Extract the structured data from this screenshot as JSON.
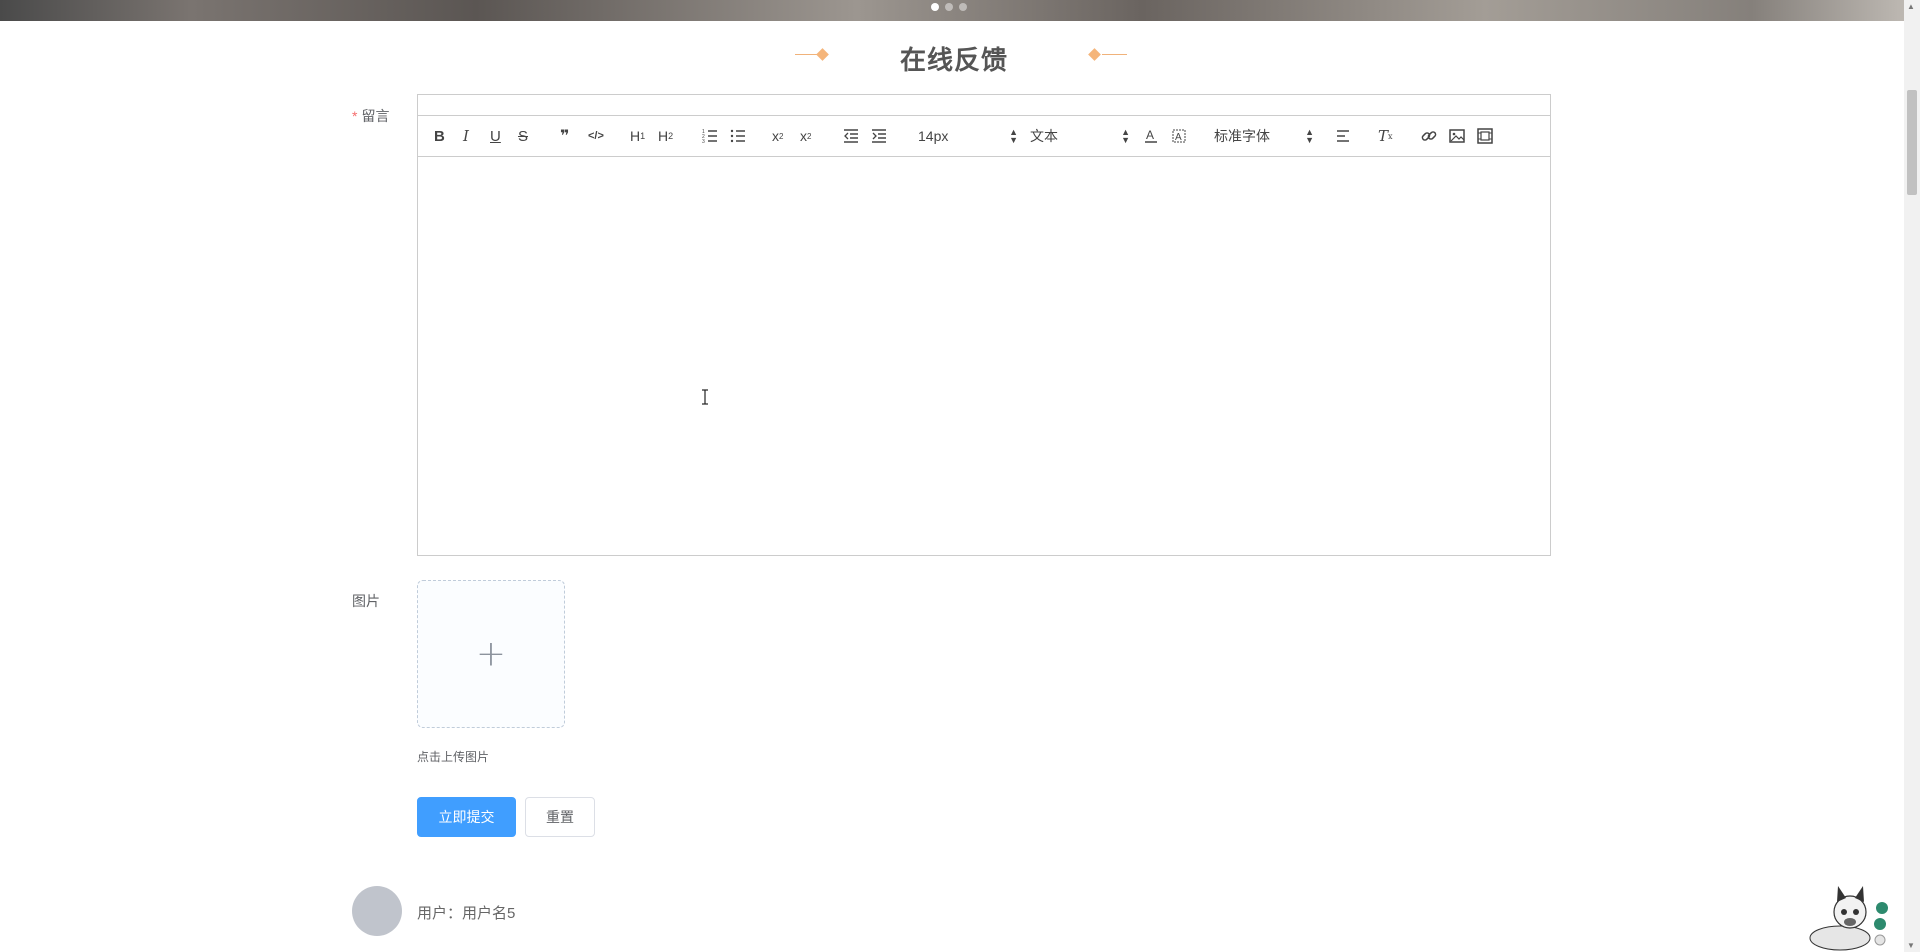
{
  "page": {
    "title": "在线反馈",
    "carousel_active_index": 0
  },
  "form": {
    "message_label": "留言",
    "required_mark": "*",
    "image_label": "图片",
    "upload_plus": "+",
    "upload_hint": "点击上传图片",
    "submit_label": "立即提交",
    "reset_label": "重置"
  },
  "editor": {
    "font_size": "14px",
    "header_format": "文本",
    "font_family": "标准字体",
    "toolbar_icons": [
      "bold-icon",
      "italic-icon",
      "underline-icon",
      "strike-icon",
      "blockquote-icon",
      "code-block-icon",
      "header1-icon",
      "header2-icon",
      "ordered-list-icon",
      "bullet-list-icon",
      "subscript-icon",
      "superscript-icon",
      "outdent-icon",
      "indent-icon",
      "text-color-icon",
      "background-color-icon",
      "align-icon",
      "clean-format-icon",
      "link-icon",
      "image-icon",
      "video-icon"
    ],
    "content": ""
  },
  "comment": {
    "user_prefix": "用户：",
    "user_name": "用户名5"
  },
  "colors": {
    "primary": "#409eff",
    "accent": "#f5b57a",
    "required": "#f56c6c"
  }
}
